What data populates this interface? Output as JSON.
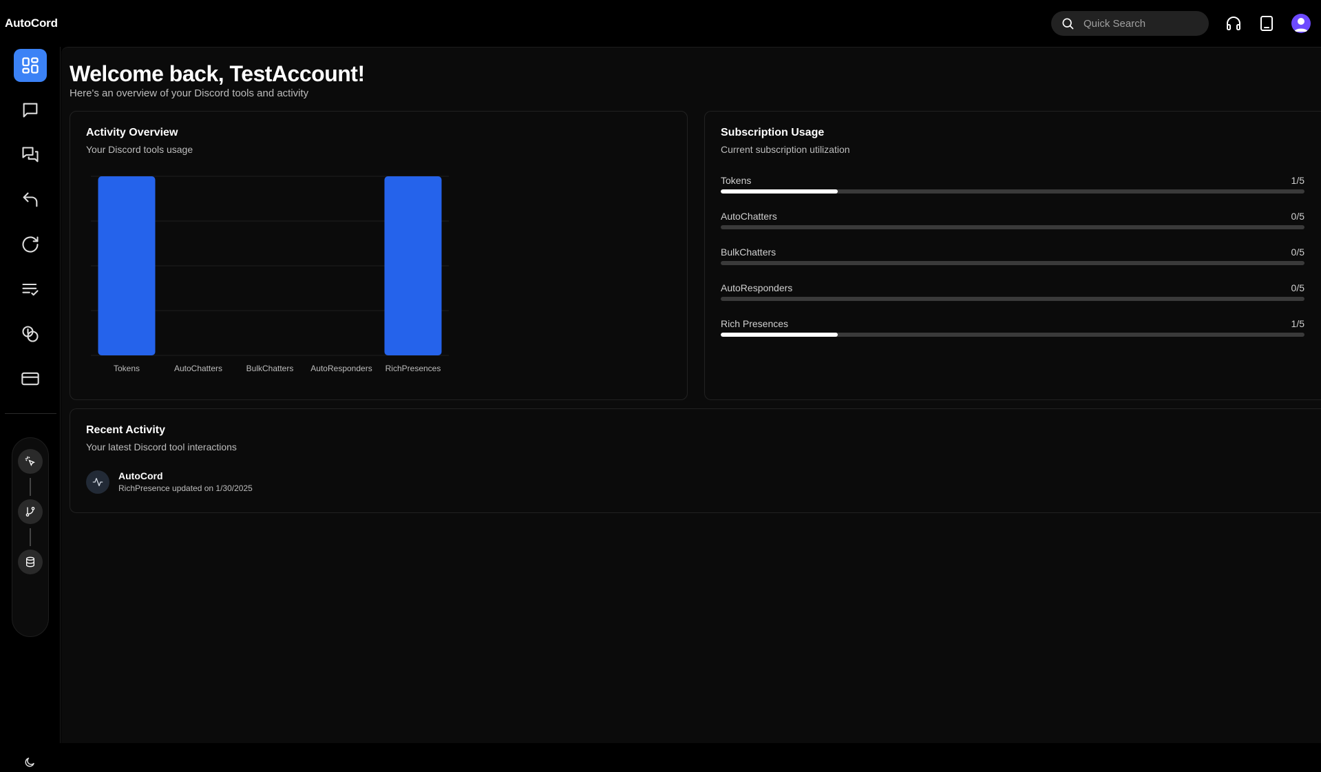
{
  "app": {
    "name": "AutoCord"
  },
  "search": {
    "placeholder": "Quick Search"
  },
  "header_icons": [
    "headset-icon",
    "tablet-icon",
    "user-avatar-icon"
  ],
  "sidebar": {
    "items": [
      {
        "name": "dashboard",
        "icon": "grid-icon",
        "active": true
      },
      {
        "name": "chat",
        "icon": "message-icon",
        "active": false
      },
      {
        "name": "bulk-chat",
        "icon": "messages-icon",
        "active": false
      },
      {
        "name": "auto-responder",
        "icon": "reply-icon",
        "active": false
      },
      {
        "name": "refresh",
        "icon": "rotate-icon",
        "active": false
      },
      {
        "name": "tasks",
        "icon": "list-check-icon",
        "active": false
      },
      {
        "name": "coins",
        "icon": "coins-icon",
        "active": false
      },
      {
        "name": "billing",
        "icon": "credit-card-icon",
        "active": false
      }
    ],
    "tools": [
      "sparkle-pointer-icon",
      "git-branch-icon",
      "database-icon"
    ],
    "theme_icon": "moon-icon"
  },
  "header": {
    "title": "Welcome back, TestAccount!",
    "subtitle": "Here's an overview of your Discord tools and activity"
  },
  "activity_overview": {
    "title": "Activity Overview",
    "subtitle": "Your Discord tools usage"
  },
  "chart_data": {
    "type": "bar",
    "categories": [
      "Tokens",
      "AutoChatters",
      "BulkChatters",
      "AutoResponders",
      "RichPresences"
    ],
    "values": [
      1,
      0,
      0,
      0,
      1
    ],
    "ylim": [
      0,
      1
    ],
    "grid": true,
    "color": "#2563eb"
  },
  "subscription_usage": {
    "title": "Subscription Usage",
    "subtitle": "Current subscription utilization",
    "items": [
      {
        "label": "Tokens",
        "value_text": "1/5",
        "fraction": 0.2
      },
      {
        "label": "AutoChatters",
        "value_text": "0/5",
        "fraction": 0
      },
      {
        "label": "BulkChatters",
        "value_text": "0/5",
        "fraction": 0
      },
      {
        "label": "AutoResponders",
        "value_text": "0/5",
        "fraction": 0
      },
      {
        "label": "Rich Presences",
        "value_text": "1/5",
        "fraction": 0.2
      }
    ]
  },
  "recent_activity": {
    "title": "Recent Activity",
    "subtitle": "Your latest Discord tool interactions",
    "items": [
      {
        "name": "AutoCord",
        "description": "RichPresence updated on 1/30/2025",
        "icon": "activity-pulse-icon"
      }
    ]
  }
}
